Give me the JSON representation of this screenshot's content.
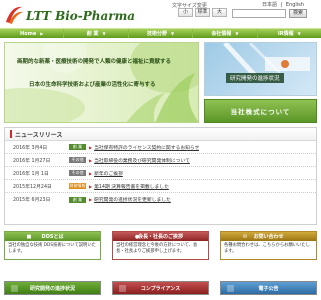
{
  "header": {
    "logo_text": "LTT Bio-Pharma",
    "font_size_label": "文字サイズ変更",
    "font_sizes": [
      "小",
      "標準",
      "大"
    ],
    "lang": [
      "日本語",
      "English"
    ],
    "lang_sep": "|",
    "search_placeholder": "",
    "search_button": "検索"
  },
  "nav": [
    {
      "label": "Home"
    },
    {
      "label": "創 業"
    },
    {
      "label": "技術分野"
    },
    {
      "label": "会社情報"
    },
    {
      "label": "IR情報"
    }
  ],
  "hero": {
    "line1": "画期的な新薬・医療技術の開発で人類の健康と福祉に貢献する",
    "line2": "日本の生命科学技術および産業の活性化に寄与する"
  },
  "side": {
    "research_label": "研究開発の進捗状況",
    "company_label": "当社株式について"
  },
  "news": {
    "title": "ニュースリリース",
    "items": [
      {
        "date": "2016年 3月4日",
        "category": "創 業",
        "text": "当社保有特許のライセンス契約に関するお知らせ"
      },
      {
        "date": "2016年 1月27日",
        "category": "その他",
        "text": "当社取締役の業務及び研究開発体制について"
      },
      {
        "date": "2016年 1月 1日",
        "category": "その他",
        "text": "新年のご挨拶"
      },
      {
        "date": "2015年12月24日",
        "category": "財務情報",
        "text": "第14期 決算報告書を掲載しました"
      },
      {
        "date": "2015年 6月23日",
        "category": "創 業",
        "text": "研究開発の進捗状況を更新しました"
      }
    ]
  },
  "panels": {
    "dds": {
      "title": "DDSとは",
      "body": "当社の独自な技術 DDS技術について説明いたします。"
    },
    "sales": {
      "title": "会長・社長のご挨拶",
      "body": "当社の経営理念と今後の方針について、会長・社長よりご挨拶申し上げます。"
    },
    "contact": {
      "title": "お問い合わせ",
      "body": "各種お問合わせは、こちらからお願いいたします。"
    }
  },
  "buttons": {
    "research": "研究開発の進捗状況",
    "compliance": "コンプライアンス",
    "public_notice": "電子公告"
  },
  "colors": {
    "nav_green": "#5f9c1a",
    "accent_red": "#cc2a2a",
    "green_bar": "#558b2f"
  }
}
